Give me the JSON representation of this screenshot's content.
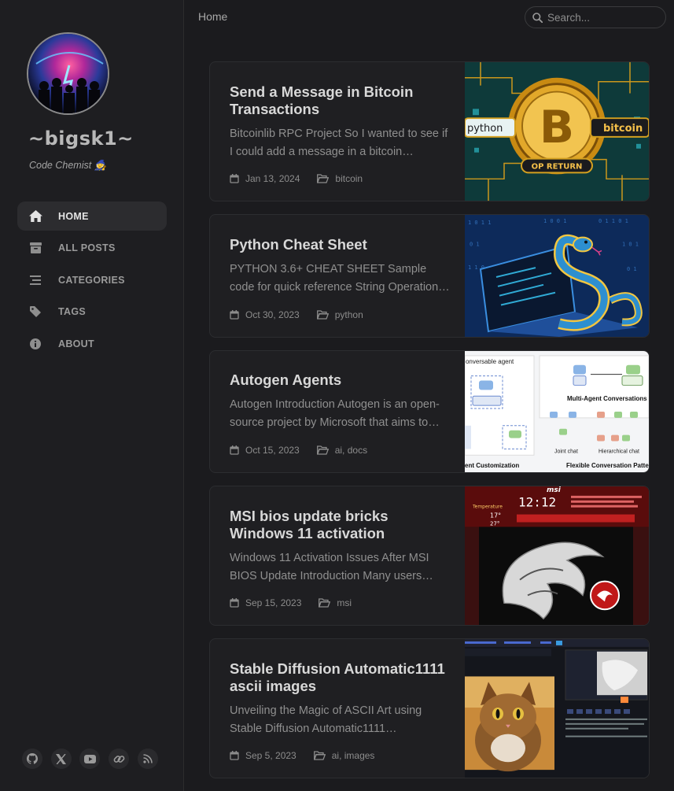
{
  "site": {
    "title": "~bigsk1~",
    "subtitle": "Code Chemist 🧙"
  },
  "nav": [
    {
      "label": "HOME",
      "icon": "home-icon"
    },
    {
      "label": "ALL POSTS",
      "icon": "archive-icon"
    },
    {
      "label": "CATEGORIES",
      "icon": "list-icon"
    },
    {
      "label": "TAGS",
      "icon": "tag-icon"
    },
    {
      "label": "ABOUT",
      "icon": "info-icon"
    }
  ],
  "social": [
    "github-icon",
    "x-icon",
    "youtube-icon",
    "link-icon",
    "rss-icon"
  ],
  "topbar": {
    "breadcrumb": "Home",
    "search_placeholder": "Search..."
  },
  "posts": [
    {
      "title": "Send a Message in Bitcoin Transactions",
      "excerpt": "Bitcoinlib RPC Project So I wanted to see if I could add a message in a bitcoin…",
      "date": "Jan 13, 2024",
      "categories": "bitcoin",
      "image": "bitcoin-op-return-image",
      "image_text": {
        "left": "python",
        "right": "bitcoin",
        "banner": "OP RETURN"
      }
    },
    {
      "title": "Python Cheat Sheet",
      "excerpt": "PYTHON 3.6+ CHEAT SHEET Sample code for quick reference String Operations #…",
      "date": "Oct 30, 2023",
      "categories": "python",
      "image": "python-snake-laptop-image"
    },
    {
      "title": "Autogen Agents",
      "excerpt": "Autogen Introduction Autogen is an open-source project by Microsoft that aims to…",
      "date": "Oct 15, 2023",
      "categories": "ai, docs",
      "image": "autogen-diagram-image",
      "image_text": {
        "top": "onversable agent",
        "multi": "Multi-Agent Conversations",
        "joint": "Joint chat",
        "hier": "Hierarchical chat",
        "bottom_left": "ent Customization",
        "bottom_right": "Flexible Conversation Patter"
      }
    },
    {
      "title": "MSI bios update bricks Windows 11 activation",
      "excerpt": "Windows 11 Activation Issues After MSI BIOS Update Introduction Many users…",
      "date": "Sep 15, 2023",
      "categories": "msi",
      "image": "msi-dragon-bios-image",
      "image_text": {
        "brand": "msi",
        "clock": "12:12",
        "temp_label": "Temperature",
        "temp1": "17°",
        "temp2": "27°"
      }
    },
    {
      "title": "Stable Diffusion Automatic1111 ascii images",
      "excerpt": "Unveiling the Magic of ASCII Art using Stable Diffusion Automatic1111…",
      "date": "Sep 5, 2023",
      "categories": "ai, images",
      "image": "stable-diffusion-cat-image"
    }
  ],
  "colors": {
    "background": "#1b1b1e",
    "sidebar": "#1e1e21",
    "card": "#1f1f22",
    "active_nav": "#2c2c2f"
  }
}
